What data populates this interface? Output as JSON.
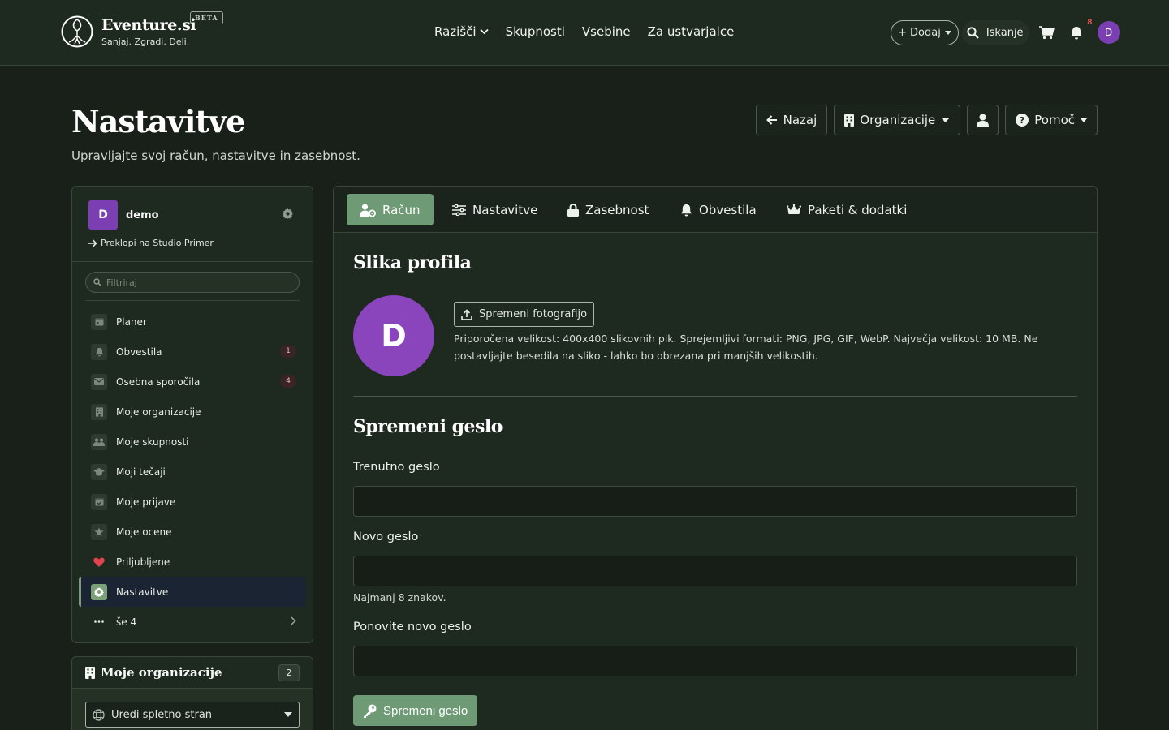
{
  "navbar": {
    "brand_name": "Eventure.si",
    "brand_tagline": "Sanjaj. Zgradi. Deli.",
    "beta_label": "BETA",
    "links": [
      {
        "label": "Razišči"
      },
      {
        "label": "Skupnosti"
      },
      {
        "label": "Vsebine"
      },
      {
        "label": "Za ustvarjalce"
      }
    ],
    "add_label": "+ Dodaj",
    "search_label": "Iskanje",
    "notification_count": "8",
    "avatar_letter": "D"
  },
  "page": {
    "title": "Nastavitve",
    "subtitle": "Upravljajte svoj račun, nastavitve in zasebnost.",
    "buttons": {
      "back": "Nazaj",
      "organizations": "Organizacije",
      "help": "Pomoč"
    }
  },
  "sidebar": {
    "user_letter": "D",
    "user_name": "demo",
    "switch_label": "Preklopi na Studio Primer",
    "filter_placeholder": "Filtriraj",
    "items": [
      {
        "label": "Planer",
        "icon": "calendar-icon",
        "badge": ""
      },
      {
        "label": "Obvestila",
        "icon": "bell-icon",
        "badge": "1"
      },
      {
        "label": "Osebna sporočila",
        "icon": "envelope-icon",
        "badge": "4"
      },
      {
        "label": "Moje organizacije",
        "icon": "building-icon",
        "badge": ""
      },
      {
        "label": "Moje skupnosti",
        "icon": "users-icon",
        "badge": ""
      },
      {
        "label": "Moji tečaji",
        "icon": "graduation-cap-icon",
        "badge": ""
      },
      {
        "label": "Moje prijave",
        "icon": "calendar-check-icon",
        "badge": ""
      },
      {
        "label": "Moje ocene",
        "icon": "star-icon",
        "badge": ""
      },
      {
        "label": "Priljubljene",
        "icon": "heart-icon",
        "badge": ""
      },
      {
        "label": "Nastavitve",
        "icon": "gear-icon",
        "badge": "",
        "active": true
      },
      {
        "label": "še 4",
        "icon": "ellipsis-icon",
        "badge": ""
      }
    ]
  },
  "orgs": {
    "title": "Moje organizacije",
    "count": "2",
    "select_label": "Uredi spletno stran"
  },
  "tabs": [
    {
      "label": "Račun",
      "icon": "user-gear-icon",
      "active": true
    },
    {
      "label": "Nastavitve",
      "icon": "sliders-icon"
    },
    {
      "label": "Zasebnost",
      "icon": "lock-icon"
    },
    {
      "label": "Obvestila",
      "icon": "bell-icon"
    },
    {
      "label": "Paketi & dodatki",
      "icon": "crown-icon"
    }
  ],
  "profile_photo": {
    "title": "Slika profila",
    "avatar_letter": "D",
    "upload_label": "Spremeni fotografijo",
    "hint": "Priporočena velikost: 400x400 slikovnih pik. Sprejemljivi formati: PNG, JPG, GIF, WebP. Največja velikost: 10 MB. Ne postavljajte besedila na sliko - lahko bo obrezana pri manjših velikostih."
  },
  "password": {
    "title": "Spremeni geslo",
    "current_label": "Trenutno geslo",
    "current_value": "",
    "new_label": "Novo geslo",
    "new_value": "",
    "new_help": "Najmanj 8 znakov.",
    "repeat_label": "Ponovite novo geslo",
    "repeat_value": "",
    "submit_label": "Spremeni geslo"
  },
  "colors": {
    "background": "#182019",
    "panel": "#1e2920",
    "accent": "#6f9a76",
    "avatar": "#8a45bd",
    "badge_text": "#e25050"
  }
}
